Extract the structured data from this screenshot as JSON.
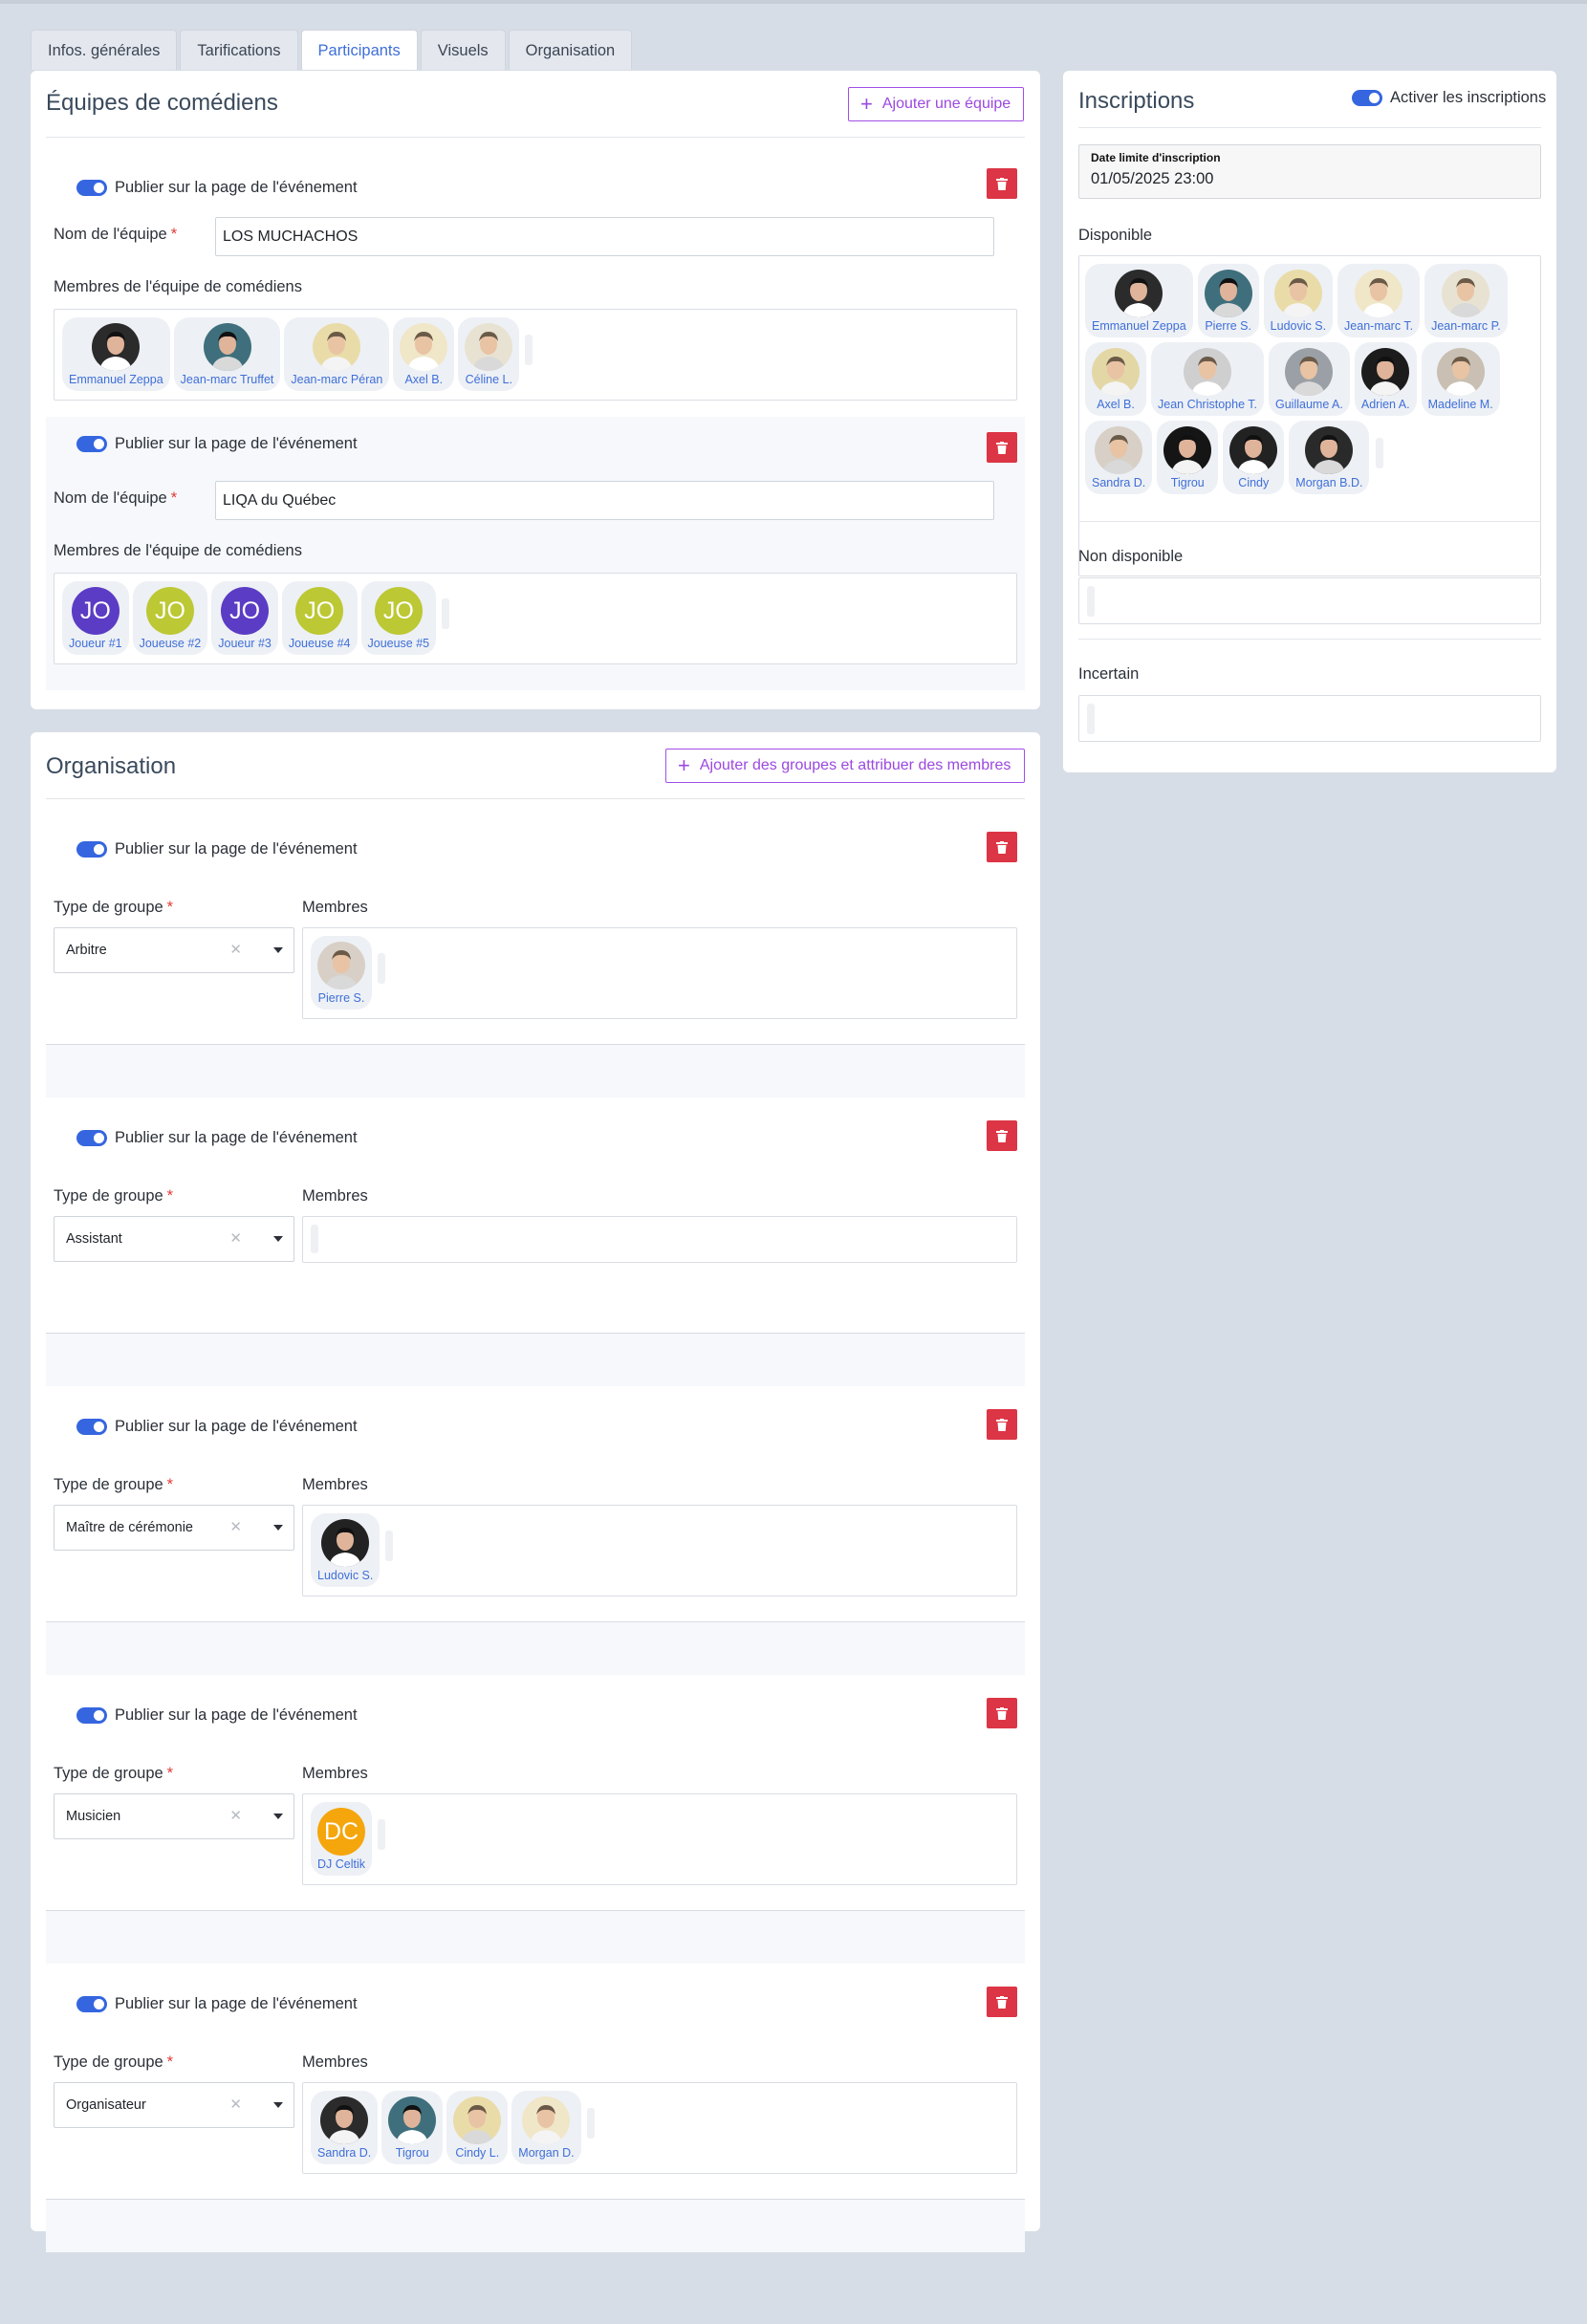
{
  "tabs": [
    "Infos. générales",
    "Tarifications",
    "Participants",
    "Visuels",
    "Organisation"
  ],
  "active_tab": "Participants",
  "teams_card": {
    "title": "Équipes de comédiens",
    "add_button": "Ajouter une équipe",
    "publish_label": "Publier sur la page de l'événement",
    "name_label": "Nom de l'équipe",
    "members_label": "Membres de l'équipe de comédiens",
    "teams": [
      {
        "name": "LOS MUCHACHOS",
        "members": [
          "Emmanuel Zeppa",
          "Jean-marc Truffet",
          "Jean-marc Péran",
          "Axel B.",
          "Céline L."
        ]
      },
      {
        "name": "LIQA du Québec",
        "members": [
          {
            "name": "Joueur #1",
            "initials": "JO",
            "color": "#5b3cc4"
          },
          {
            "name": "Joueuse #2",
            "initials": "JO",
            "color": "#bcc834"
          },
          {
            "name": "Joueur #3",
            "initials": "JO",
            "color": "#5b3cc4"
          },
          {
            "name": "Joueuse #4",
            "initials": "JO",
            "color": "#bcc834"
          },
          {
            "name": "Joueuse #5",
            "initials": "JO",
            "color": "#bcc834"
          }
        ]
      }
    ]
  },
  "org_card": {
    "title": "Organisation",
    "add_button": "Ajouter des groupes et attribuer des membres",
    "publish_label": "Publier sur la page de l'événement",
    "type_label": "Type de groupe",
    "members_label": "Membres",
    "groups": [
      {
        "type": "Arbitre",
        "members": [
          "Pierre S."
        ]
      },
      {
        "type": "Assistant",
        "members": []
      },
      {
        "type": "Maître de cérémonie",
        "members": [
          "Ludovic S."
        ]
      },
      {
        "type": "Musicien",
        "members": [
          {
            "name": "DJ Celtik",
            "initials": "DC",
            "color": "#f5a60c"
          }
        ]
      },
      {
        "type": "Organisateur",
        "members": [
          "Sandra D.",
          "Tigrou",
          "Cindy L.",
          "Morgan D."
        ]
      }
    ]
  },
  "registrations": {
    "title": "Inscriptions",
    "toggle_label": "Activer les inscriptions",
    "deadline_label": "Date limite d'inscription",
    "deadline_value": "01/05/2025 23:00",
    "available_label": "Disponible",
    "available": [
      "Emmanuel Zeppa",
      "Pierre S.",
      "Ludovic S.",
      "Jean-marc T.",
      "Jean-marc P.",
      "Axel B.",
      "Jean Christophe T.",
      "Guillaume A.",
      "Adrien A.",
      "Madeline M.",
      "Sandra D.",
      "Tigrou",
      "Cindy",
      "Morgan B.D."
    ],
    "unavailable_label": "Non disponible",
    "uncertain_label": "Incertain"
  },
  "icons": {
    "delete": "trash-icon",
    "add": "plus-icon",
    "clear": "clear-icon",
    "dropdown": "caret-down-icon"
  },
  "colors": {
    "accent": "#3566e0",
    "delete": "#dc3545",
    "outline": "#a24ee6"
  }
}
